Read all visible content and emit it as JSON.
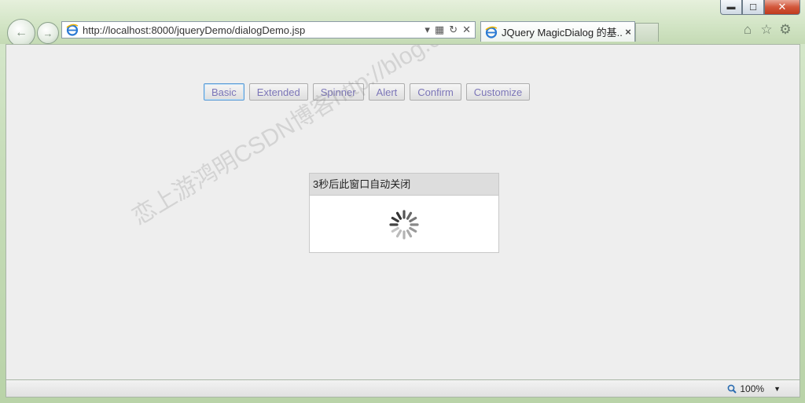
{
  "browser": {
    "address": "http://localhost:8000/jqueryDemo/dialogDemo.jsp",
    "tab_title": "JQuery MagicDialog 的基...",
    "window_controls": {
      "minimize": "▬",
      "maximize": "☐",
      "close": "✕"
    },
    "toolbar_icons": [
      "home-icon",
      "star-icon",
      "gear-icon"
    ]
  },
  "page": {
    "buttons": [
      {
        "label": "Basic",
        "focused": true
      },
      {
        "label": "Extended"
      },
      {
        "label": "Spinner"
      },
      {
        "label": "Alert"
      },
      {
        "label": "Confirm"
      },
      {
        "label": "Customize"
      }
    ],
    "dialog": {
      "title": "3秒后此窗口自动关闭"
    },
    "watermark": "恋上游鸿明CSDN博客http://blog.csdn.net/youqishini"
  },
  "status": {
    "zoom": "100%"
  },
  "colors": {
    "button_text": "#7c76b8",
    "content_bg": "#eeeeee",
    "dialog_header": "#dddddd"
  }
}
